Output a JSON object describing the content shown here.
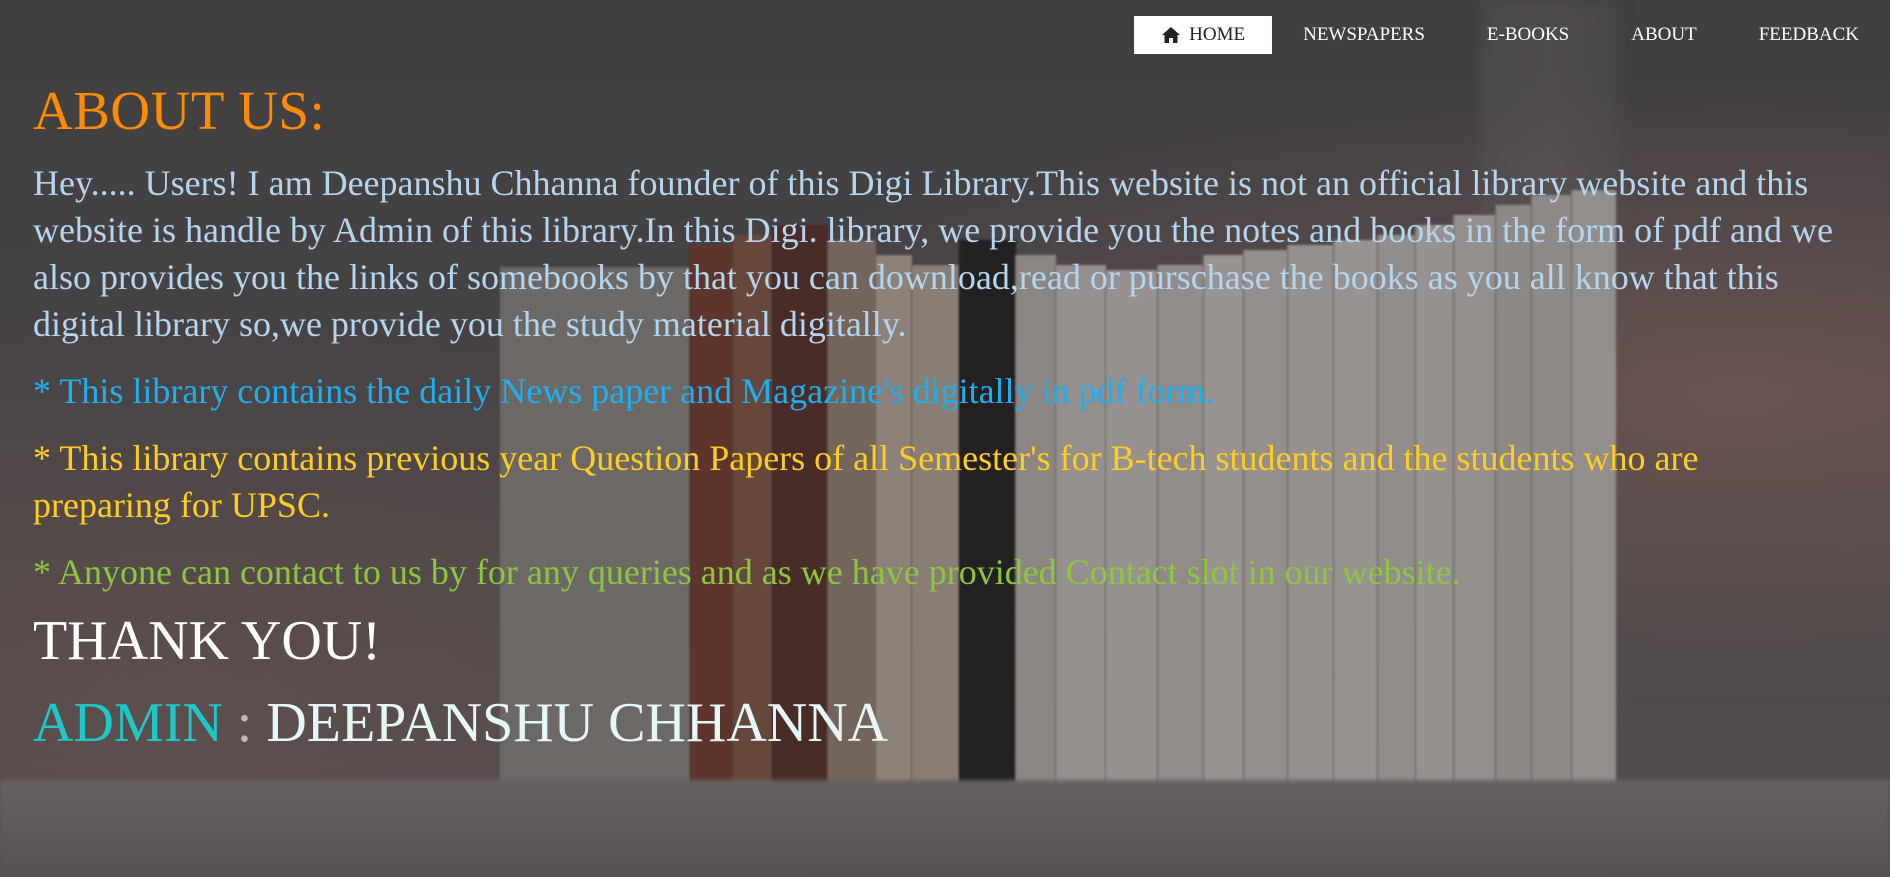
{
  "nav": {
    "items": [
      {
        "label": "HOME",
        "icon": "home-icon",
        "active": true
      },
      {
        "label": "NEWSPAPERS"
      },
      {
        "label": "E-BOOKS"
      },
      {
        "label": "ABOUT"
      },
      {
        "label": "FEEDBACK"
      }
    ]
  },
  "main": {
    "title": "ABOUT US:",
    "intro": "Hey..... Users! I am Deepanshu Chhanna founder of this Digi Library.This website is not an official library website and this website is handle by Admin of this library.In this Digi. library, we provide you the notes and books in the form of pdf and we also provides you the links of somebooks by that you can download,read or purschase the books as you all know that this digital library so,we provide you the study material digitally.",
    "point_news": "* This library contains the daily News paper and Magazine's digitally in pdf form.",
    "point_papers": "* This library contains previous year Question Papers of all Semester's for B-tech students and the students who are preparing for UPSC.",
    "point_contact": "* Anyone can contact to us by for any queries and as we have provided Contact slot in our website.",
    "thanks": "THANK YOU!",
    "admin_label": "ADMIN",
    "admin_sep": ":",
    "admin_name": "DEEPANSHU CHHANNA"
  },
  "colors": {
    "title": "#ff8c00",
    "intro": "#b5d5ee",
    "news": "#1faeee",
    "papers": "#ffcc22",
    "contact": "#8cc63f",
    "admin_label": "#1fc8c8"
  }
}
